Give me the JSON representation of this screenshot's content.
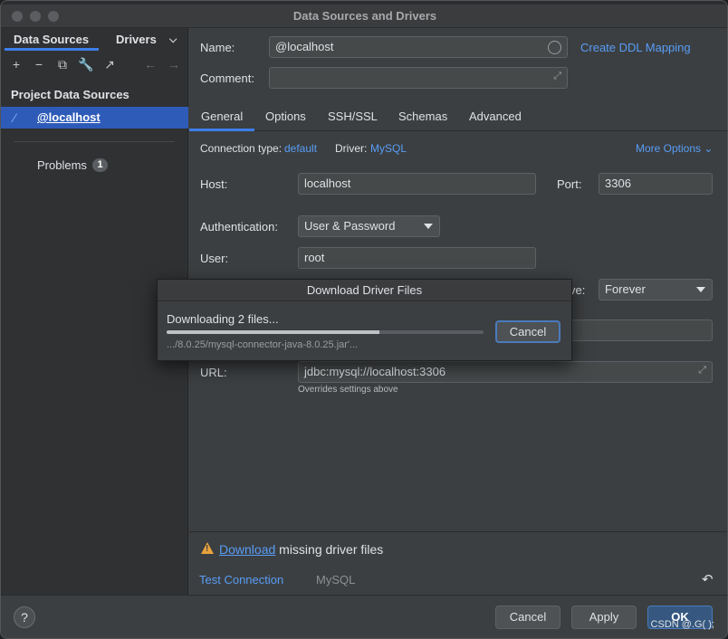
{
  "window": {
    "title": "Data Sources and Drivers"
  },
  "left": {
    "tabs": [
      "Data Sources",
      "Drivers"
    ],
    "toolbar_icons": [
      "add-icon",
      "remove-icon",
      "copy-icon",
      "wrench-icon",
      "jump-icon",
      "back-icon",
      "forward-icon"
    ],
    "section_label": "Project Data Sources",
    "datasource": "@localhost",
    "problems_label": "Problems",
    "problems_count": "1"
  },
  "form": {
    "name_label": "Name:",
    "name_value": "@localhost",
    "ddl_link": "Create DDL Mapping",
    "comment_label": "Comment:",
    "comment_value": ""
  },
  "tabs": [
    "General",
    "Options",
    "SSH/SSL",
    "Schemas",
    "Advanced"
  ],
  "general": {
    "conn_type_label": "Connection type:",
    "conn_type_value": "default",
    "driver_label": "Driver:",
    "driver_value": "MySQL",
    "more_options": "More Options",
    "host_label": "Host:",
    "host_value": "localhost",
    "port_label": "Port:",
    "port_value": "3306",
    "auth_label": "Authentication:",
    "auth_value": "User & Password",
    "user_label": "User:",
    "user_value": "root",
    "save_label_fragment": "ve:",
    "save_value": "Forever",
    "url_label": "URL:",
    "url_value": "jdbc:mysql://localhost:3306",
    "url_hint": "Overrides settings above"
  },
  "warning": {
    "link": "Download",
    "text": "missing driver files"
  },
  "bottom_links": {
    "test_connection": "Test Connection",
    "dbms": "MySQL"
  },
  "footer": {
    "help": "?",
    "cancel": "Cancel",
    "apply": "Apply",
    "ok": "OK",
    "watermark": "CSDN @.G( );"
  },
  "dialog": {
    "title": "Download Driver Files",
    "status": "Downloading 2 files...",
    "progress": 0.67,
    "file": ".../8.0.25/mysql-connector-java-8.0.25.jar'...",
    "cancel": "Cancel"
  },
  "colors": {
    "accent": "#3d7eea",
    "link": "#589df6",
    "warning": "#e8a33d"
  }
}
